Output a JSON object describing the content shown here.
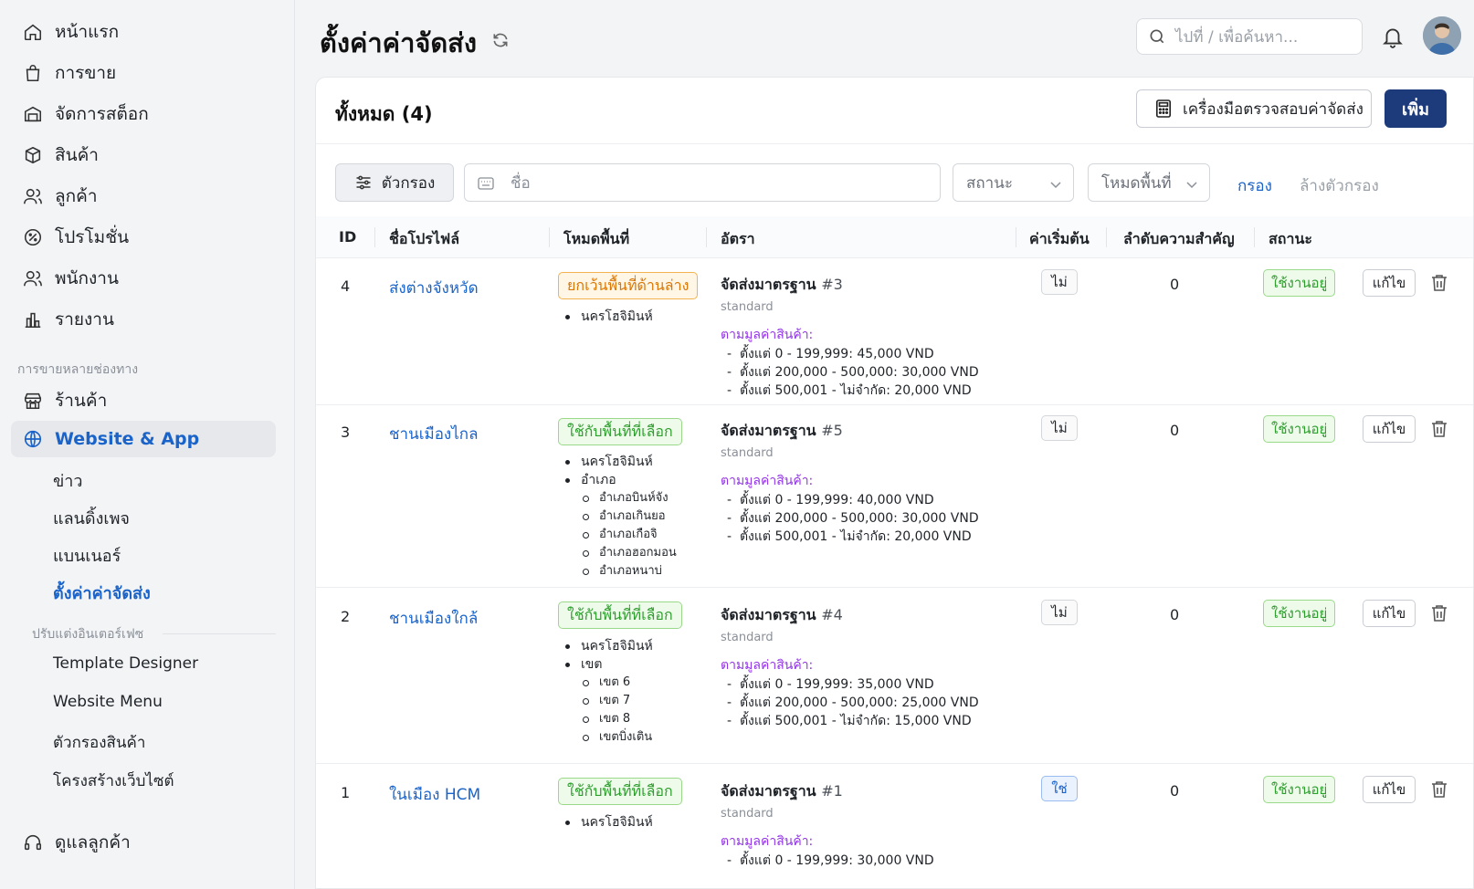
{
  "sidebar": {
    "items": [
      {
        "label": "หน้าแรก",
        "icon": "home-icon"
      },
      {
        "label": "การขาย",
        "icon": "shopping-bag-icon"
      },
      {
        "label": "จัดการสต็อก",
        "icon": "warehouse-icon"
      },
      {
        "label": "สินค้า",
        "icon": "box-icon"
      },
      {
        "label": "ลูกค้า",
        "icon": "users-icon"
      },
      {
        "label": "โปรโมชั่น",
        "icon": "promotion-icon"
      },
      {
        "label": "พนักงาน",
        "icon": "staff-icon"
      },
      {
        "label": "รายงาน",
        "icon": "chart-icon"
      }
    ],
    "section_multichannel": "การขายหลายช่องทาง",
    "store": "ร้านค้า",
    "website_app": "Website & App",
    "sub_items": [
      "ข่าว",
      "แลนดิ้งเพจ",
      "แบนเนอร์",
      "ตั้งค่าค่าจัดส่ง"
    ],
    "section_customize": "ปรับแต่งอินเตอร์เฟซ",
    "customize_items": [
      "Template Designer",
      "Website Menu",
      "ตัวกรองสินค้า",
      "โครงสร้างเว็บไซต์"
    ],
    "support": "ดูแลลูกค้า"
  },
  "header": {
    "title": "ตั้งค่าค่าจัดส่ง",
    "search_placeholder": "ไปที่ / เพื่อค้นหา..."
  },
  "card": {
    "title": "ทั้งหมด (4)",
    "tool_button": "เครื่องมือตรวจสอบค่าจัดส่ง",
    "add_button": "เพิ่ม"
  },
  "filters": {
    "filter_button": "ตัวกรอง",
    "name_placeholder": "ชื่อ",
    "status_select": "สถานะ",
    "area_mode_select": "โหมดพื้นที่",
    "apply": "กรอง",
    "clear": "ล้างตัวกรอง"
  },
  "table": {
    "columns": [
      "ID",
      "ชื่อโปรไฟล์",
      "โหมดพื้นที่",
      "อัตรา",
      "ค่าเริ่มต้น",
      "ลำดับความสำคัญ",
      "สถานะ"
    ],
    "edit_label": "แก้ไข",
    "rate_by_label": "ตามมูลค่าสินค้า:",
    "rows": [
      {
        "id": "4",
        "name": "ส่งต่างจังหวัด",
        "area_mode": "ยกเว้นพื้นที่ด้านล่าง",
        "area_mode_color": "orange",
        "areas": [
          "นครโฮจิมินห์"
        ],
        "sub_areas": [],
        "rate_name": "จัดส่งมาตรฐาน",
        "rate_num": "#3",
        "rate_type": "standard",
        "tiers": [
          "ตั้งแต่ 0 - 199,999: 45,000 VND",
          "ตั้งแต่ 200,000 - 500,000: 30,000 VND",
          "ตั้งแต่ 500,001 - ไม่จำกัด: 20,000 VND"
        ],
        "default": "ไม่",
        "priority": "0",
        "status": "ใช้งานอยู่"
      },
      {
        "id": "3",
        "name": "ชานเมืองไกล",
        "area_mode": "ใช้กับพื้นที่ที่เลือก",
        "area_mode_color": "green",
        "areas": [
          "นครโฮจิมินห์",
          "อำเภอ"
        ],
        "sub_areas": [
          "อำเภอบินห์จัง",
          "อำเภอเกินยอ",
          "อำเภอเกือจิ",
          "อำเภอฮอกมอน",
          "อำเภอหนาบ่"
        ],
        "rate_name": "จัดส่งมาตรฐาน",
        "rate_num": "#5",
        "rate_type": "standard",
        "tiers": [
          "ตั้งแต่ 0 - 199,999: 40,000 VND",
          "ตั้งแต่ 200,000 - 500,000: 30,000 VND",
          "ตั้งแต่ 500,001 - ไม่จำกัด: 20,000 VND"
        ],
        "default": "ไม่",
        "priority": "0",
        "status": "ใช้งานอยู่"
      },
      {
        "id": "2",
        "name": "ชานเมืองใกล้",
        "area_mode": "ใช้กับพื้นที่ที่เลือก",
        "area_mode_color": "green",
        "areas": [
          "นครโฮจิมินห์",
          "เขต"
        ],
        "sub_areas": [
          "เขต 6",
          "เขต 7",
          "เขต 8",
          "เขตบิ่งเติน"
        ],
        "rate_name": "จัดส่งมาตรฐาน",
        "rate_num": "#4",
        "rate_type": "standard",
        "tiers": [
          "ตั้งแต่ 0 - 199,999: 35,000 VND",
          "ตั้งแต่ 200,000 - 500,000: 25,000 VND",
          "ตั้งแต่ 500,001 - ไม่จำกัด: 15,000 VND"
        ],
        "default": "ไม่",
        "priority": "0",
        "status": "ใช้งานอยู่"
      },
      {
        "id": "1",
        "name": "ในเมือง HCM",
        "area_mode": "ใช้กับพื้นที่ที่เลือก",
        "area_mode_color": "green",
        "areas": [
          "นครโฮจิมินห์"
        ],
        "sub_areas": [],
        "rate_name": "จัดส่งมาตรฐาน",
        "rate_num": "#1",
        "rate_type": "standard",
        "tiers": [
          "ตั้งแต่ 0 - 199,999: 30,000 VND"
        ],
        "default": "ใช่",
        "priority": "0",
        "status": "ใช้งานอยู่"
      }
    ]
  },
  "colors": {
    "accent": "#1a63c9",
    "primary_button": "#1d3a7a",
    "active_green": "#2f9e2f",
    "rate_label": "#9333ea"
  }
}
